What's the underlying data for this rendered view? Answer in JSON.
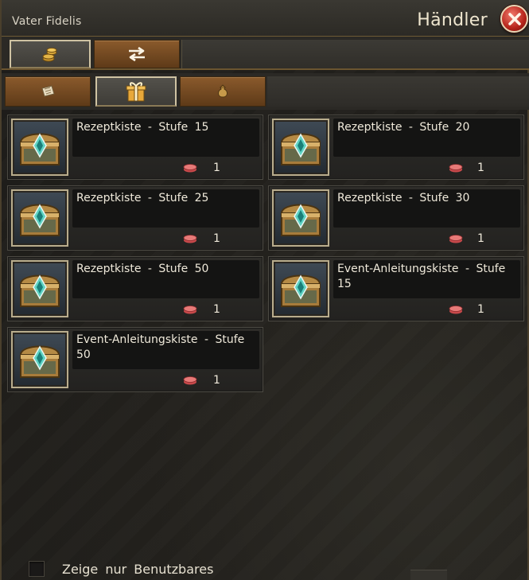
{
  "header": {
    "npc_name": "Vater Fidelis",
    "title": "Händler"
  },
  "main_tabs": [
    {
      "name": "buy",
      "icon": "coins-icon",
      "active": true
    },
    {
      "name": "exchange",
      "icon": "swap-arrows-icon",
      "active": false
    }
  ],
  "category_tabs": [
    {
      "name": "scrolls",
      "icon": "scroll-icon",
      "active": false
    },
    {
      "name": "boxes",
      "icon": "gift-box-icon",
      "active": true
    },
    {
      "name": "bags",
      "icon": "money-bag-icon",
      "active": false
    }
  ],
  "items": [
    {
      "name": "Rezeptkiste - Stufe 15",
      "price": "1",
      "currency_icon": "token-icon"
    },
    {
      "name": "Rezeptkiste - Stufe 20",
      "price": "1",
      "currency_icon": "token-icon"
    },
    {
      "name": "Rezeptkiste - Stufe 25",
      "price": "1",
      "currency_icon": "token-icon"
    },
    {
      "name": "Rezeptkiste - Stufe 30",
      "price": "1",
      "currency_icon": "token-icon"
    },
    {
      "name": "Rezeptkiste - Stufe 50",
      "price": "1",
      "currency_icon": "token-icon"
    },
    {
      "name": "Event-Anleitungskiste - Stufe 15",
      "price": "1",
      "currency_icon": "token-icon"
    },
    {
      "name": "Event-Anleitungskiste - Stufe 50",
      "price": "1",
      "currency_icon": "token-icon"
    }
  ],
  "filter": {
    "label": "Zeige nur Benutzbares",
    "checked": false
  },
  "colors": {
    "accent_gold": "#cfc3a3",
    "tab_bronze": "#8a5a2c",
    "close_red": "#b6241a"
  }
}
